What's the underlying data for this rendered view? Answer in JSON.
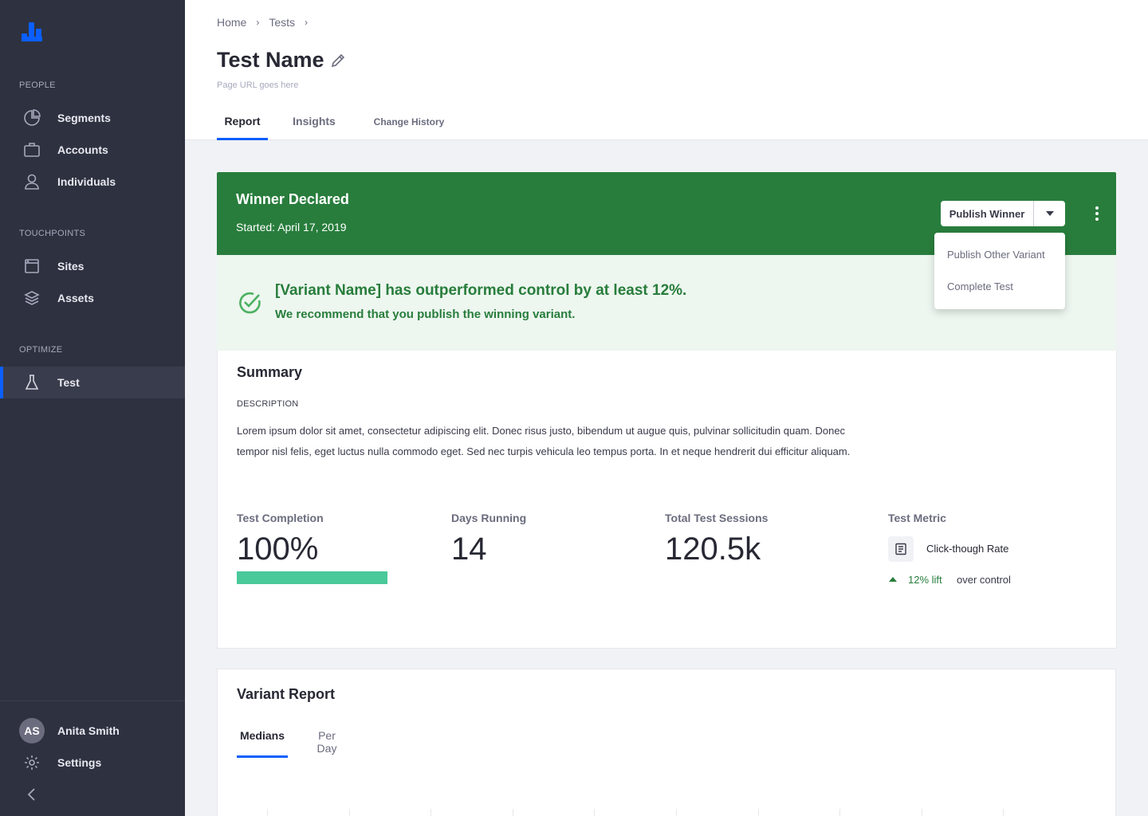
{
  "sidebar": {
    "sections": [
      {
        "title": "PEOPLE"
      },
      {
        "title": "TOUCHPOINTS"
      },
      {
        "title": "OPTIMIZE"
      }
    ],
    "items": [
      {
        "label": "Segments",
        "icon": "pie-chart-icon"
      },
      {
        "label": "Accounts",
        "icon": "briefcase-icon"
      },
      {
        "label": "Individuals",
        "icon": "user-icon"
      },
      {
        "label": "Sites",
        "icon": "browser-window-icon"
      },
      {
        "label": "Assets",
        "icon": "layers-icon"
      },
      {
        "label": "Test",
        "icon": "flask-icon",
        "active": true
      }
    ],
    "user": {
      "initials": "AS",
      "name": "Anita Smith"
    },
    "settings_label": "Settings"
  },
  "header": {
    "breadcrumb": [
      "Home",
      "Tests"
    ],
    "title": "Test Name",
    "url": "Page URL goes here",
    "tabs": [
      {
        "label": "Report",
        "active": true
      },
      {
        "label": "Insights"
      },
      {
        "label": "Change History"
      }
    ]
  },
  "winner": {
    "title": "Winner Declared",
    "started": "Started: April 17, 2019",
    "publish_label": "Publish Winner",
    "message": "[Variant Name] has outperformed control by at least 12%.",
    "recommendation": "We recommend that you publish the winning variant.",
    "dropdown": [
      "Publish Other Variant",
      "Complete Test"
    ]
  },
  "summary": {
    "title": "Summary",
    "description_label": "DESCRIPTION",
    "description": "Lorem ipsum dolor sit amet, consectetur adipiscing elit. Donec risus justo, bibendum ut augue quis, pulvinar sollicitudin quam. Donec tempor nisl felis, eget luctus nulla commodo eget. Sed nec turpis vehicula leo tempus porta. In et neque hendrerit dui efficitur aliquam.",
    "stats": {
      "completion": {
        "label": "Test Completion",
        "value": "100%",
        "progress": 1.0
      },
      "days": {
        "label": "Days Running",
        "value": "14"
      },
      "sessions": {
        "label": "Total Test Sessions",
        "value": "120.5k"
      },
      "metric": {
        "label": "Test Metric",
        "name": "Click-though Rate",
        "lift": "12% lift",
        "lift_text": "over control"
      }
    }
  },
  "variant_report": {
    "title": "Variant Report",
    "tabs": [
      {
        "label": "Medians",
        "active": true
      },
      {
        "label": "Per Day"
      }
    ]
  },
  "colors": {
    "accent": "#0b5fff",
    "success": "#287d3c",
    "sidebar": "#2e3140",
    "progress": "#4ac99b"
  }
}
